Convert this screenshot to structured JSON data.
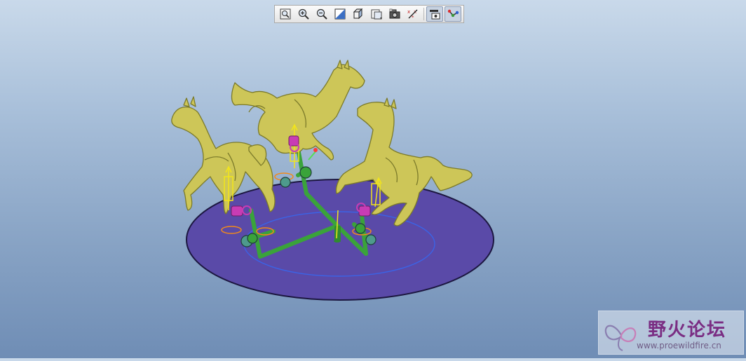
{
  "toolbar": {
    "buttons": [
      {
        "name": "refit-icon",
        "active": false
      },
      {
        "name": "zoom-in-icon",
        "active": false
      },
      {
        "name": "zoom-out-icon",
        "active": false
      },
      {
        "name": "repaint-icon",
        "active": false
      },
      {
        "name": "display-style-icon",
        "active": false
      },
      {
        "name": "saved-views-icon",
        "active": false
      },
      {
        "name": "camera-icon",
        "active": false
      },
      {
        "name": "datum-display-icon",
        "active": false
      },
      {
        "name": "spin-center-icon",
        "active": true
      },
      {
        "name": "mechanism-display-icon",
        "active": true
      }
    ]
  },
  "colors": {
    "background_top": "#c9d9ea",
    "background_bottom": "#6f8db5",
    "horse_fill": "#cdc658",
    "horse_stroke": "#7b7a2a",
    "base_fill": "#5a4aa8",
    "base_stroke": "#1c1740",
    "linkage": "#3aa33a",
    "joint_marker": "#f2e51a",
    "connector": "#c83cb4"
  },
  "watermark": {
    "title": "野火论坛",
    "url": "www.proewildfire.cn"
  }
}
